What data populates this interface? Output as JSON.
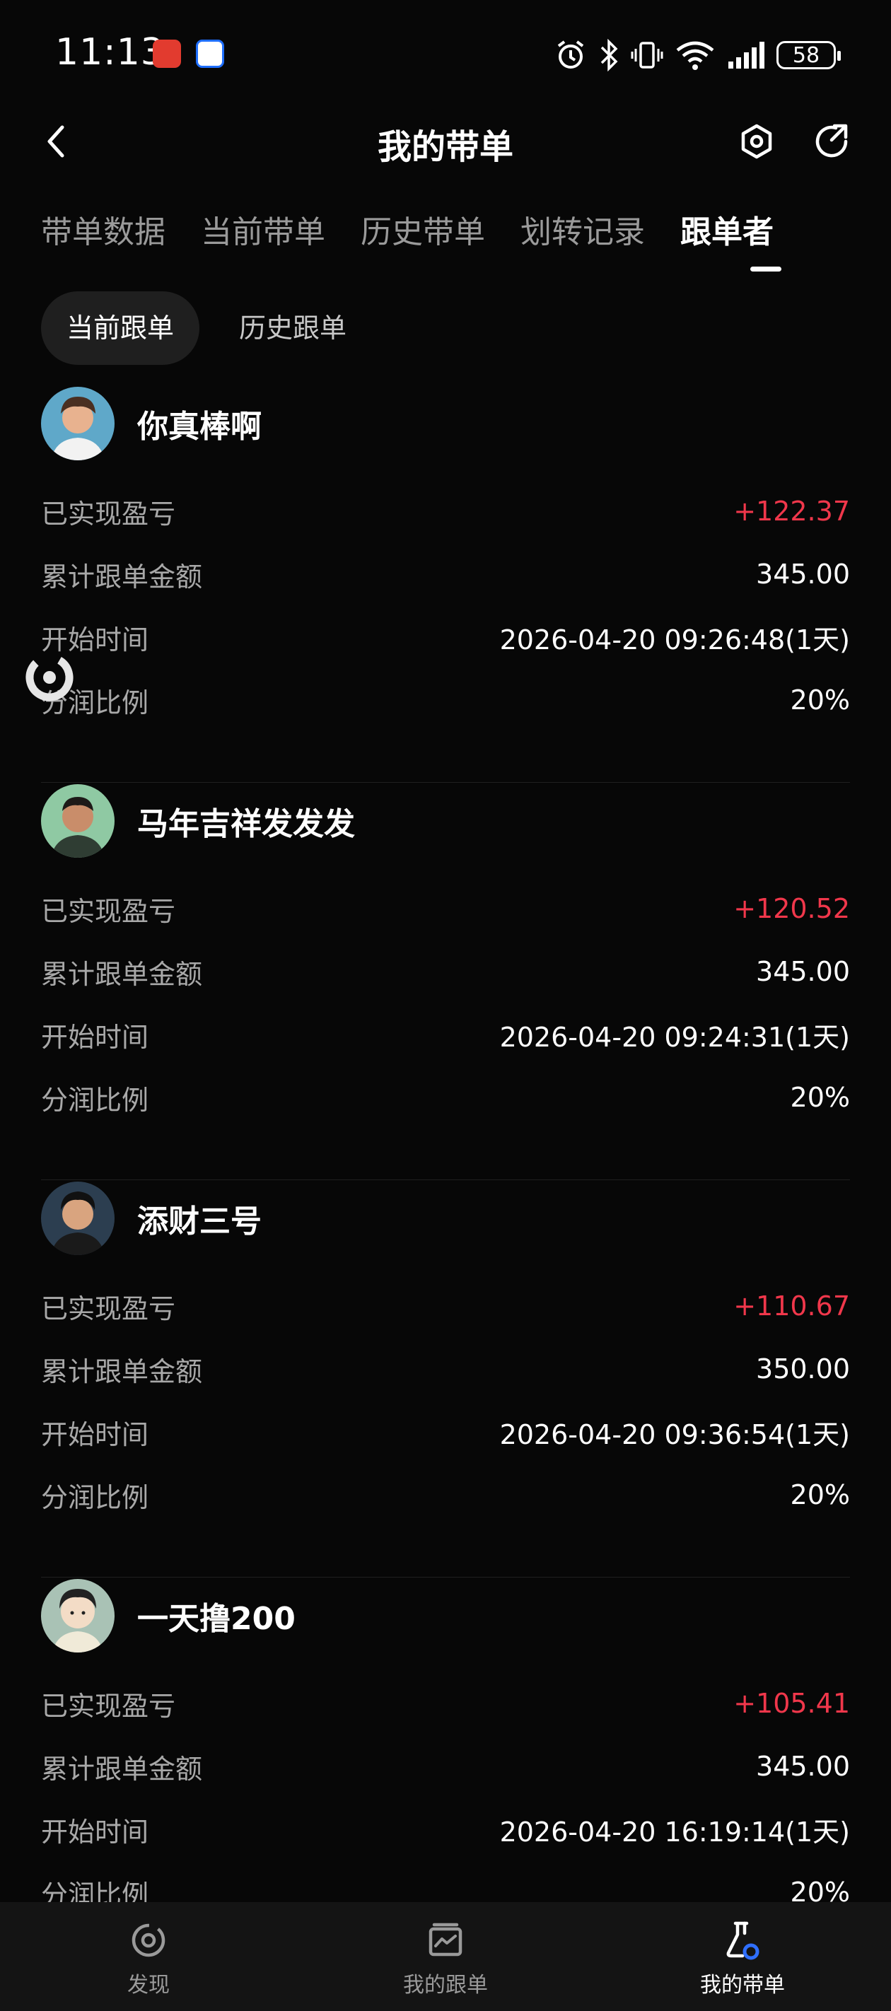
{
  "status_bar": {
    "time": "11:13",
    "battery": "58"
  },
  "header": {
    "title": "我的带单"
  },
  "tabs": [
    {
      "label": "带单数据",
      "active": false
    },
    {
      "label": "当前带单",
      "active": false
    },
    {
      "label": "历史带单",
      "active": false
    },
    {
      "label": "划转记录",
      "active": false
    },
    {
      "label": "跟单者",
      "active": true
    }
  ],
  "subtabs": [
    {
      "label": "当前跟单",
      "active": true
    },
    {
      "label": "历史跟单",
      "active": false
    }
  ],
  "labels": {
    "realized_pnl": "已实现盈亏",
    "total_amount": "累计跟单金额",
    "start_time": "开始时间",
    "profit_share": "分润比例"
  },
  "followers": [
    {
      "name": "你真棒啊",
      "realized_pnl": "+122.37",
      "total_amount": "345.00",
      "start_time": "2026-04-20 09:26:48(1天)",
      "profit_share": "20%",
      "avatar_bg": "#5fa8c9"
    },
    {
      "name": "马年吉祥发发发",
      "realized_pnl": "+120.52",
      "total_amount": "345.00",
      "start_time": "2026-04-20 09:24:31(1天)",
      "profit_share": "20%",
      "avatar_bg": "#8fc9a3"
    },
    {
      "name": "添财三号",
      "realized_pnl": "+110.67",
      "total_amount": "350.00",
      "start_time": "2026-04-20 09:36:54(1天)",
      "profit_share": "20%",
      "avatar_bg": "#2c3e50"
    },
    {
      "name": "一天撸200",
      "realized_pnl": "+105.41",
      "total_amount": "345.00",
      "start_time": "2026-04-20 16:19:14(1天)",
      "profit_share": "20%",
      "avatar_bg": "#a9c2b5"
    }
  ],
  "bottom_nav": [
    {
      "label": "发现",
      "icon": "discover-icon",
      "active": false
    },
    {
      "label": "我的跟单",
      "icon": "chart-card-icon",
      "active": false
    },
    {
      "label": "我的带单",
      "icon": "flask-icon",
      "active": true
    }
  ],
  "colors": {
    "background": "#070707",
    "profit": "#f0374b",
    "label": "#a8a8a8",
    "nav_bg": "#141414"
  }
}
